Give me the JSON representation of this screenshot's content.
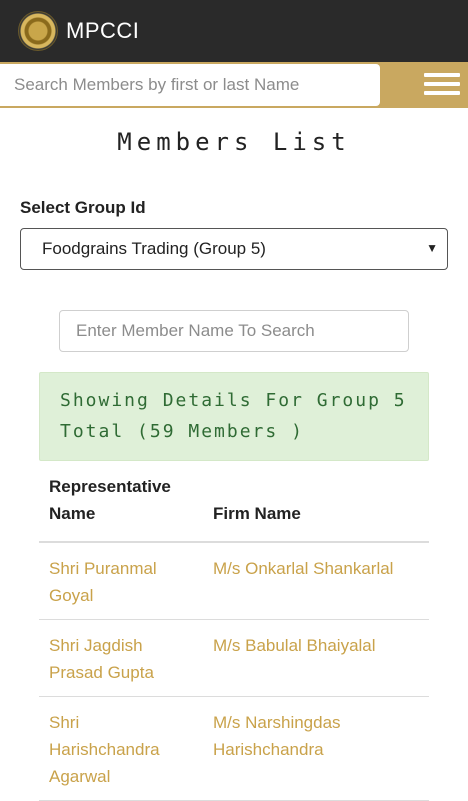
{
  "appbar": {
    "title": "MPCCI",
    "logo_icon": "mpcci-seal-logo"
  },
  "search": {
    "placeholder": "Search Members by first or last Name"
  },
  "page": {
    "title": "Members List"
  },
  "group": {
    "label": "Select Group Id",
    "selected": "Foodgrains Trading (Group 5)"
  },
  "member_search": {
    "placeholder": "Enter Member Name To Search"
  },
  "info": {
    "line1": "Showing Details For Group 5",
    "line2": "Total (59 Members )"
  },
  "table": {
    "headers": {
      "representative": "Representative Name",
      "firm": "Firm Name"
    },
    "rows": [
      {
        "representative": "Shri Puranmal Goyal",
        "firm": "M/s Onkarlal Shankarlal"
      },
      {
        "representative": "Shri Jagdish Prasad Gupta",
        "firm": "M/s Babulal Bhaiyalal"
      },
      {
        "representative": "Shri Harishchandra Agarwal",
        "firm": "M/s Narshingdas Harishchandra"
      }
    ]
  },
  "colors": {
    "appbar": "#2a2a2a",
    "accent_gold": "#c9a860",
    "link_gold": "#c9a24a",
    "info_bg": "#dff0d8",
    "info_text": "#2f6b34"
  }
}
